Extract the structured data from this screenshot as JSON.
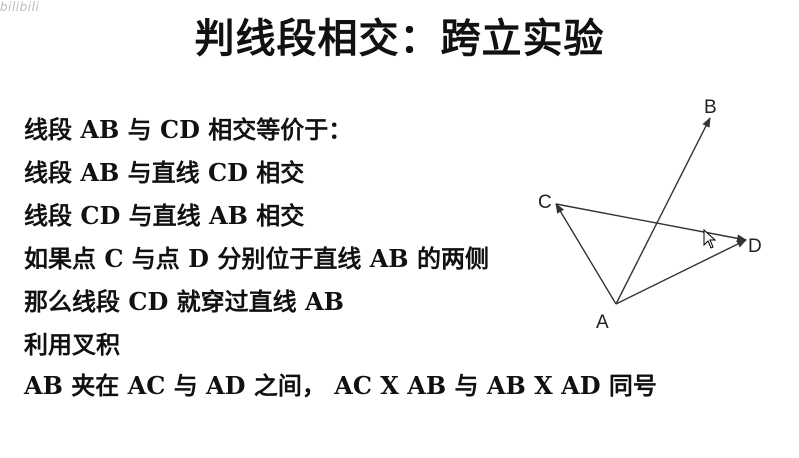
{
  "watermark": "bilibili",
  "title": "判线段相交：跨立实验",
  "lines": [
    "线段 AB 与 CD 相交等价于：",
    "线段 AB 与直线 CD 相交",
    "线段 CD 与直线 AB 相交",
    "如果点 C 与点 D 分别位于直线 AB 的两侧",
    "那么线段 CD 就穿过直线 AB",
    "利用叉积"
  ],
  "last_line": "AB 夹在 AC 与 AD 之间， AC X AB  与  AB X AD  同号",
  "diagram": {
    "labels": {
      "A": "A",
      "B": "B",
      "C": "C",
      "D": "D"
    },
    "stroke_color": "#333333"
  },
  "cursor": "pointer-cursor-icon"
}
